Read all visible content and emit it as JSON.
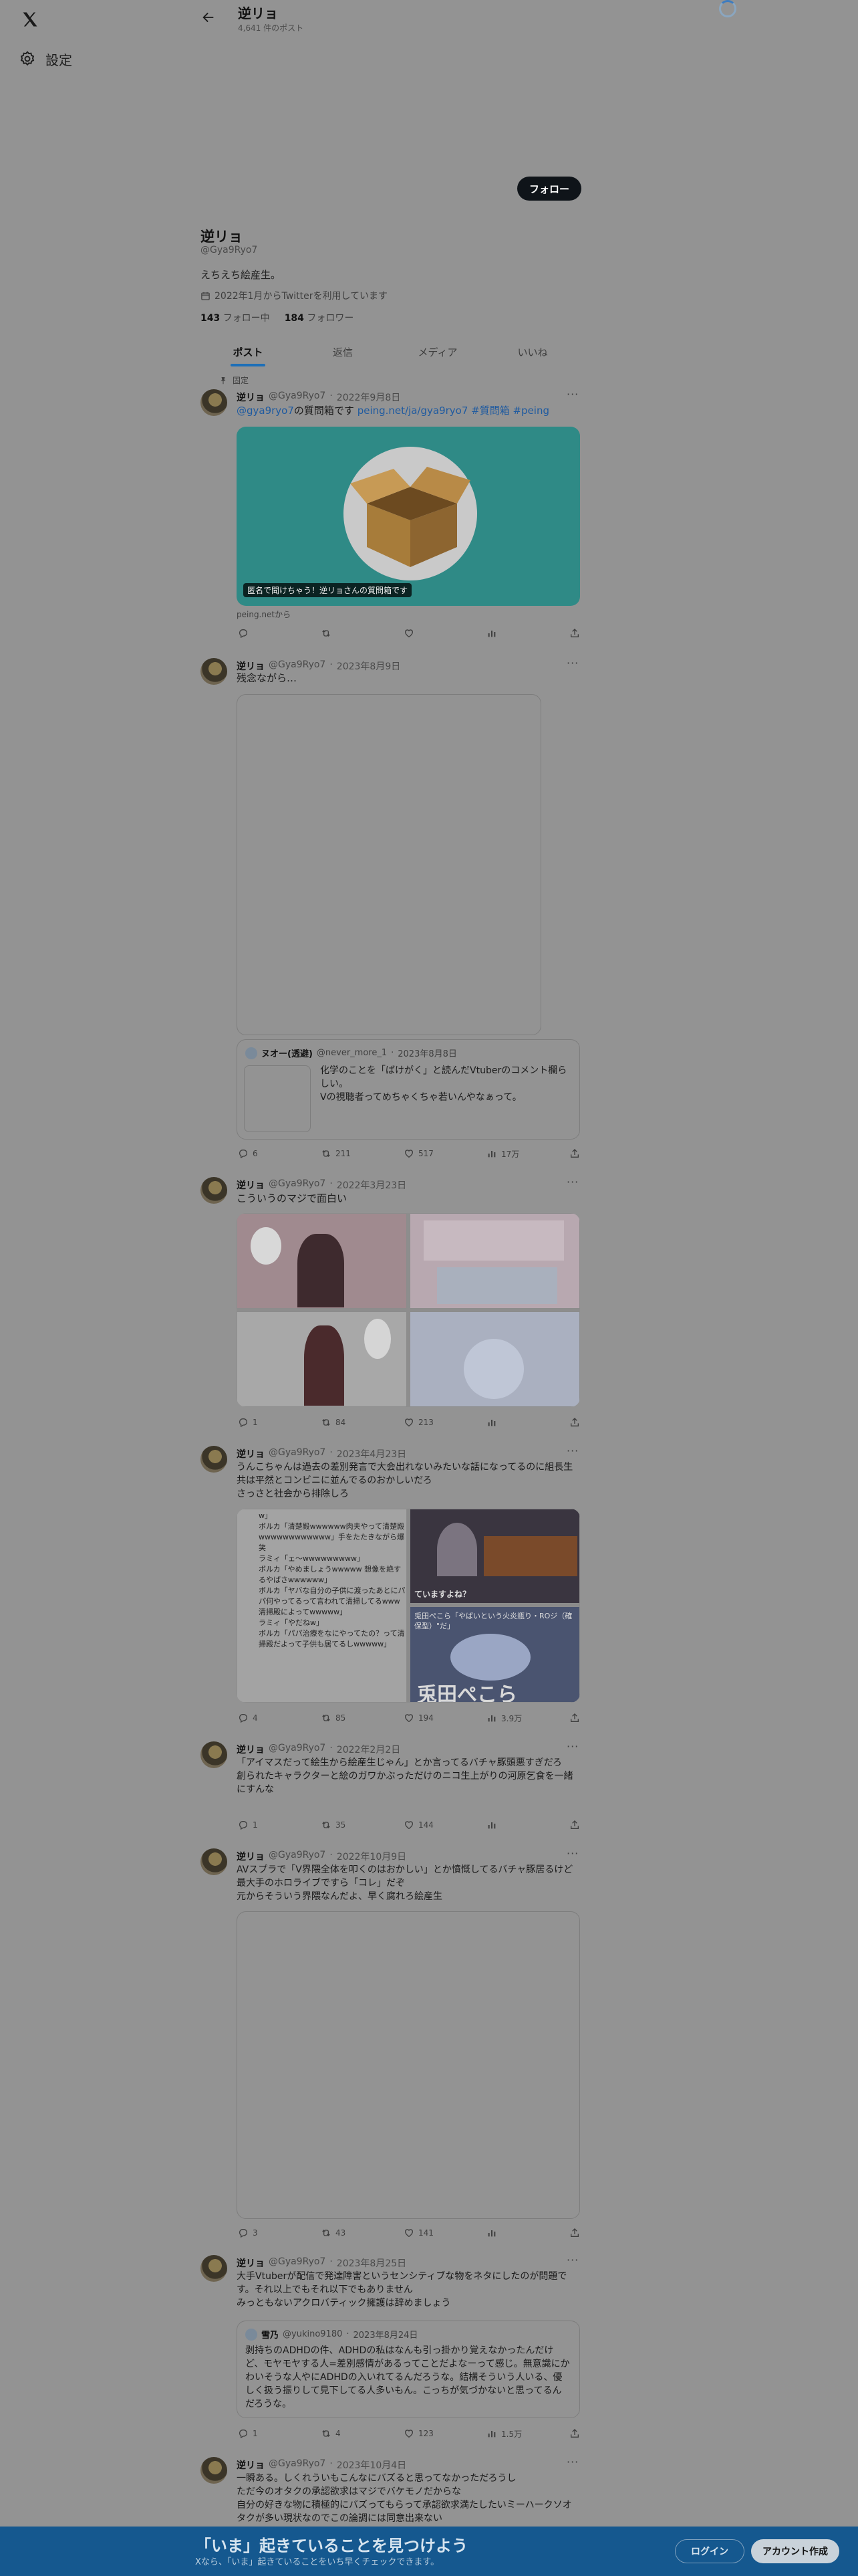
{
  "colors": {
    "page_dim": "#939393",
    "accent": "#1d6fb8",
    "banner": "#15588f",
    "link": "#1e5aa0"
  },
  "nav": {
    "settings_label": "設定",
    "logo_icon": "x-logo-icon",
    "settings_icon": "gear-icon"
  },
  "header": {
    "name": "逆リョ",
    "post_count": "4,641 件のポスト"
  },
  "profile": {
    "follow_label": "フォロー",
    "name": "逆リョ",
    "handle": "@Gya9Ryo7",
    "bio": "えちえち絵産生。",
    "joined": "2022年1月からTwitterを利用しています",
    "following_count": "143",
    "following_label": "フォロー中",
    "followers_count": "184",
    "followers_label": "フォロワー"
  },
  "tabs": [
    {
      "label": "ポスト",
      "active": true
    },
    {
      "label": "返信",
      "active": false
    },
    {
      "label": "メディア",
      "active": false
    },
    {
      "label": "いいね",
      "active": false
    }
  ],
  "pinned_label": "固定",
  "tweets": [
    {
      "name": "逆リョ",
      "handle": "@Gya9Ryo7",
      "date": "2022年9月8日",
      "text_link1": "@gya9ryo7",
      "text_mid": "の質問箱です ",
      "text_link2": "peing.net/ja/gya9ryo7 #質問箱 #peing",
      "card_caption": "匿名で聞けちゃう！逆リョさんの質問箱です",
      "card_source": "peing.netから"
    },
    {
      "name": "逆リョ",
      "handle": "@Gya9Ryo7",
      "date": "2023年8月9日",
      "text": "残念ながら…",
      "quote": {
        "name": "ヌオー(透避)",
        "handle": "@never_more_1",
        "date": "2023年8月8日",
        "text": "化学のことを「ばけがく」と読んだVtuberのコメント欄らしい。\nVの視聴者ってめちゃくちゃ若いんやなぁって。"
      },
      "replies": "6",
      "reposts": "211",
      "likes": "517",
      "views": "17万"
    },
    {
      "name": "逆リョ",
      "handle": "@Gya9Ryo7",
      "date": "2022年3月23日",
      "text": "こういうのマジで面白い",
      "replies": "1",
      "reposts": "84",
      "likes": "213",
      "views": ""
    },
    {
      "name": "逆リョ",
      "handle": "@Gya9Ryo7",
      "date": "2023年4月23日",
      "text": "うんこちゃんは過去の差別発言で大会出れないみたいな話になってるのに組長生共は平然とコンビニに並んでるのおかしいだろ\nさっさと社会から排除しろ",
      "img_left_lines": [
        "w」",
        "ボルカ「清楚殿wwwwww肉夫やって清楚殿wwwwwwwwwwww」手をたたきながら爆笑",
        "ラミィ「ェ～wwwwwwwww」",
        "ボルカ「やめましょうwwwww 想像を絶するやばさwwwwww」",
        "ボルカ「ヤバな自分の子供に渡ったあとにパパ何やってるって言われて清掃してるwww清掃殿によってwwwww」",
        "ラミィ「やだねw」",
        "ボルカ「パパ治療をなにやってたの？って清掃殿だよって子供も居てるしwwwww」"
      ],
      "img_right_caption1": "ていますよね？",
      "img_right_caption2": "兎田ぺこら「やばいという火炎瓶り・ROジ（確保型）\"だ」",
      "img_right_big": "兎田ぺこら",
      "replies": "4",
      "reposts": "85",
      "likes": "194",
      "views": "3.9万"
    },
    {
      "name": "逆リョ",
      "handle": "@Gya9Ryo7",
      "date": "2022年2月2日",
      "text": "「アイマスだって絵生から絵産生じゃん」とか言ってるバチャ豚頭悪すぎだろ\n創られたキャラクターと絵のガワかぶっただけのニコ生上がりの河原乞食を一緒にすんな",
      "replies": "1",
      "reposts": "35",
      "likes": "144",
      "views": ""
    },
    {
      "name": "逆リョ",
      "handle": "@Gya9Ryo7",
      "date": "2022年10月9日",
      "text": "AVスプラで「V界隈全体を叩くのはおかしい」とか憤慨してるバチャ豚居るけど最大手のホロライブですら「コレ」だぞ\n元からそういう界隈なんだよ、早く腐れろ絵産生",
      "replies": "3",
      "reposts": "43",
      "likes": "141",
      "views": ""
    },
    {
      "name": "逆リョ",
      "handle": "@Gya9Ryo7",
      "date": "2023年8月25日",
      "text": "大手Vtuberが配信で発達障害というセンシティブな物をネタにしたのが問題です。それ以上でもそれ以下でもありません\nみっともないアクロバティック擁護は辞めましょう",
      "quote": {
        "name": "雪乃",
        "handle": "@yukino9180",
        "date": "2023年8月24日",
        "text": "剥持ちのADHDの件、ADHDの私はなんも引っ掛かり覚えなかったんだけど、モヤモヤする人=差別感情があるってことだよなーって感じ。無意識にかわいそうな人やにADHDの入いれてるんだろうな。結構そういう人いる、優しく扱う振りして見下してる人多いもん。こっちが気づかないと思ってるんだろうな。"
      },
      "replies": "1",
      "reposts": "4",
      "likes": "123",
      "views": "1.5万"
    },
    {
      "name": "逆リョ",
      "handle": "@Gya9Ryo7",
      "date": "2023年10月4日",
      "text": "一瞬ある。しくれういもこんなにバズると思ってなかっただろうし\nただ今のオタクの承認欲求はマジでバケモノだからな\n自分の好きな物に積極的にバズってもらって承認欲求満たしたいミーハークソオタクが多い現状なのでこの論調には同意出来ない"
    }
  ],
  "banner": {
    "title": "「いま」起きていることを見つけよう",
    "subtitle": "Xなら、「いま」起きていることをいち早くチェックできます。",
    "login": "ログイン",
    "signup": "アカウント作成"
  }
}
